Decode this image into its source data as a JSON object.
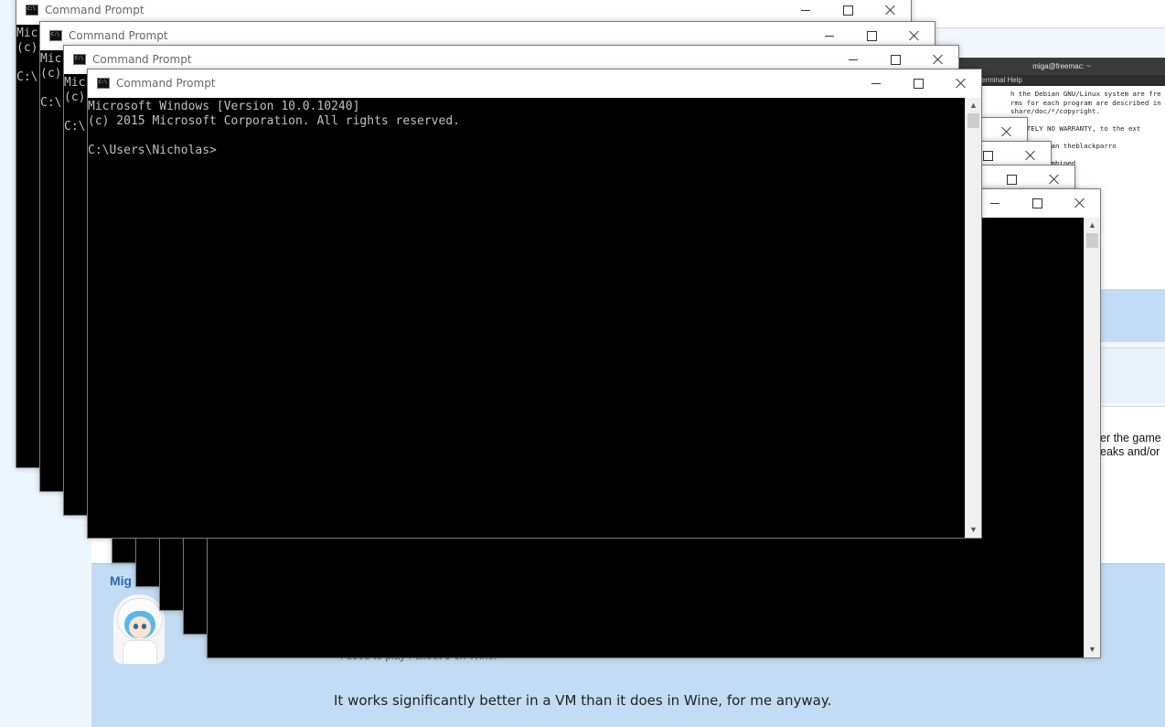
{
  "window_title": "Command Prompt",
  "console": {
    "line1": "Microsoft Windows [Version 10.0.10240]",
    "line2": "(c) 2015 Microsoft Corporation. All rights reserved.",
    "prompt": "C:\\Users\\Nicholas>",
    "partial1": "Mic",
    "partial2": "(c)",
    "partial3": "C:\\"
  },
  "linux_terminal": {
    "title": "miga@freemac: ~",
    "menu": "erminal  Help",
    "lines": [
      "h the Debian GNU/Linux system are fre",
      "rms for each program are described in",
      "share/doc/*/copyright.",
      "",
      "SOLUTELY NO WARRANTY, to the ext",
      "",
      "rminals than theblackparro",
      "",
      "and pch combined"
    ]
  },
  "forum": {
    "author": "Mig",
    "quote_text": "I used to play Fallout 3 on Wine.",
    "post_text": "It works significantly better in a VM than it does in Wine, for me anyway.",
    "side_text": "er the game\neaks and/or"
  }
}
